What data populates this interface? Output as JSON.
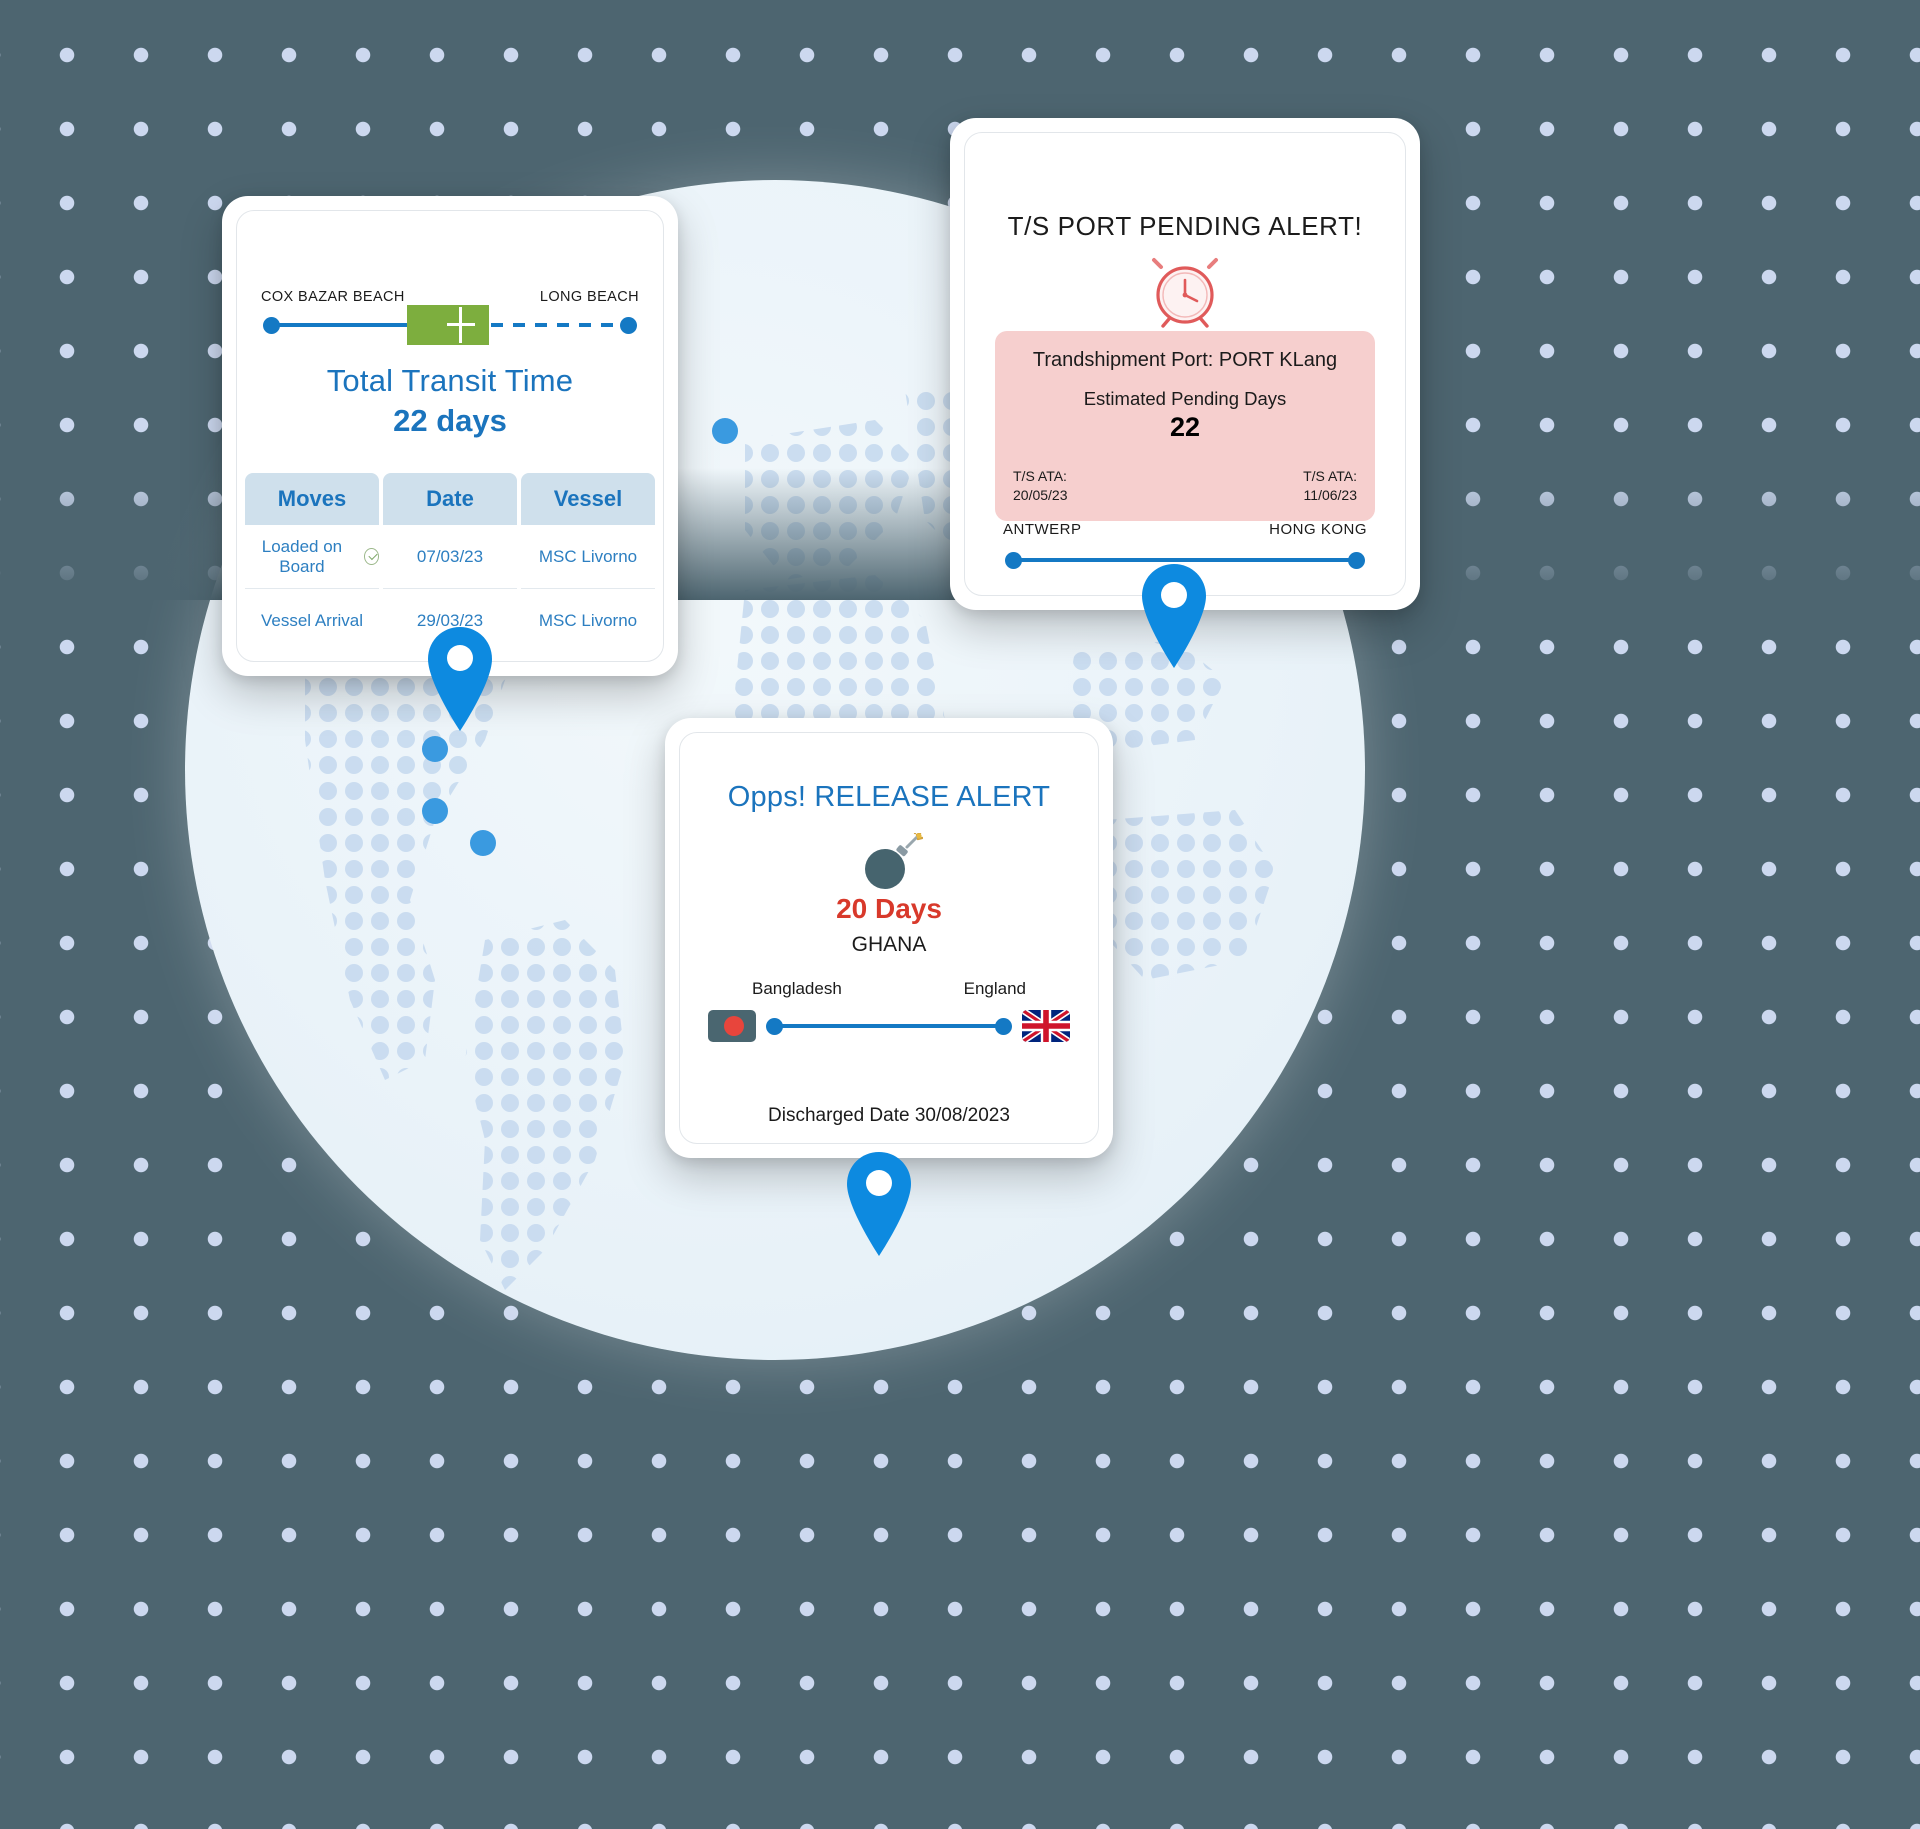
{
  "theme": {
    "background": "#4d6570",
    "dot_color": "#ccd8ef",
    "accent_blue": "#1479c4",
    "title_blue": "#1b74bd",
    "alert_pink": "#f6cfce",
    "alert_red": "#d8392b",
    "green": "#7dae3e"
  },
  "transit_card": {
    "origin_label": "COX BAZAR BEACH",
    "destination_label": "LONG BEACH",
    "title": "Total Transit Time",
    "value": "22 days",
    "table": {
      "headers": [
        "Moves",
        "Date",
        "Vessel"
      ],
      "rows": [
        {
          "move": "Loaded on Board",
          "date": "07/03/23",
          "vessel": "MSC Livorno",
          "status_icon": "check-circle-icon"
        },
        {
          "move": "Vessel Arrival",
          "date": "29/03/23",
          "vessel": "MSC Livorno",
          "status_icon": ""
        }
      ]
    }
  },
  "ts_alert_card": {
    "title": "T/S PORT PENDING ALERT!",
    "icon": "alarm-clock-icon",
    "transhipment_port": "Trandshipment Port: PORT KLang",
    "pending_days_label": "Estimated Pending Days",
    "pending_days_value": "22",
    "ata_left_label": "T/S ATA:",
    "ata_left_value": "20/05/23",
    "ata_right_label": "T/S ATA:",
    "ata_right_value": "11/06/23",
    "route_origin": "ANTWERP",
    "route_destination": "HONG KONG"
  },
  "release_alert_card": {
    "title": "Opps! RELEASE ALERT",
    "icon": "bomb-icon",
    "days": "20 Days",
    "country": "GHANA",
    "route_origin": "Bangladesh",
    "route_destination": "England",
    "origin_flag": "bangladesh-flag-icon",
    "destination_flag": "uk-flag-icon",
    "discharged": "Discharged Date 30/08/2023"
  },
  "map_pins": [
    {
      "name": "map-pin-transit"
    },
    {
      "name": "map-pin-ts-alert"
    },
    {
      "name": "map-pin-release"
    }
  ]
}
